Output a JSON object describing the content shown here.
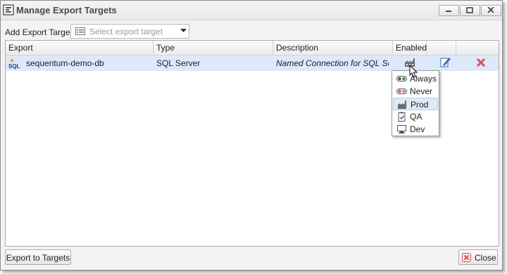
{
  "window": {
    "title": "Manage Export Targets",
    "icon": "export-targets-icon"
  },
  "add_target": {
    "label": "Add Export Target",
    "placeholder": "Select export target"
  },
  "grid": {
    "columns": [
      "Export",
      "Type",
      "Description",
      "Enabled"
    ],
    "rows": [
      {
        "export": "sequentum-demo-db",
        "type": "SQL Server",
        "description": "Named Connection for SQL Ser...",
        "enabled_icon": "prod-factory-icon"
      }
    ]
  },
  "enabled_menu": {
    "items": [
      {
        "label": "Always",
        "icon": "toggle-on-icon"
      },
      {
        "label": "Never",
        "icon": "toggle-off-icon"
      },
      {
        "label": "Prod",
        "icon": "factory-icon",
        "selected": true
      },
      {
        "label": "QA",
        "icon": "clipboard-check-icon"
      },
      {
        "label": "Dev",
        "icon": "monitor-icon"
      }
    ]
  },
  "footer": {
    "export_button": "Export to Targets",
    "close_button": "Close"
  },
  "colors": {
    "selected_row": "#dde8fb",
    "delete_red": "#d9534f",
    "sql_gold": "#e8a900"
  }
}
